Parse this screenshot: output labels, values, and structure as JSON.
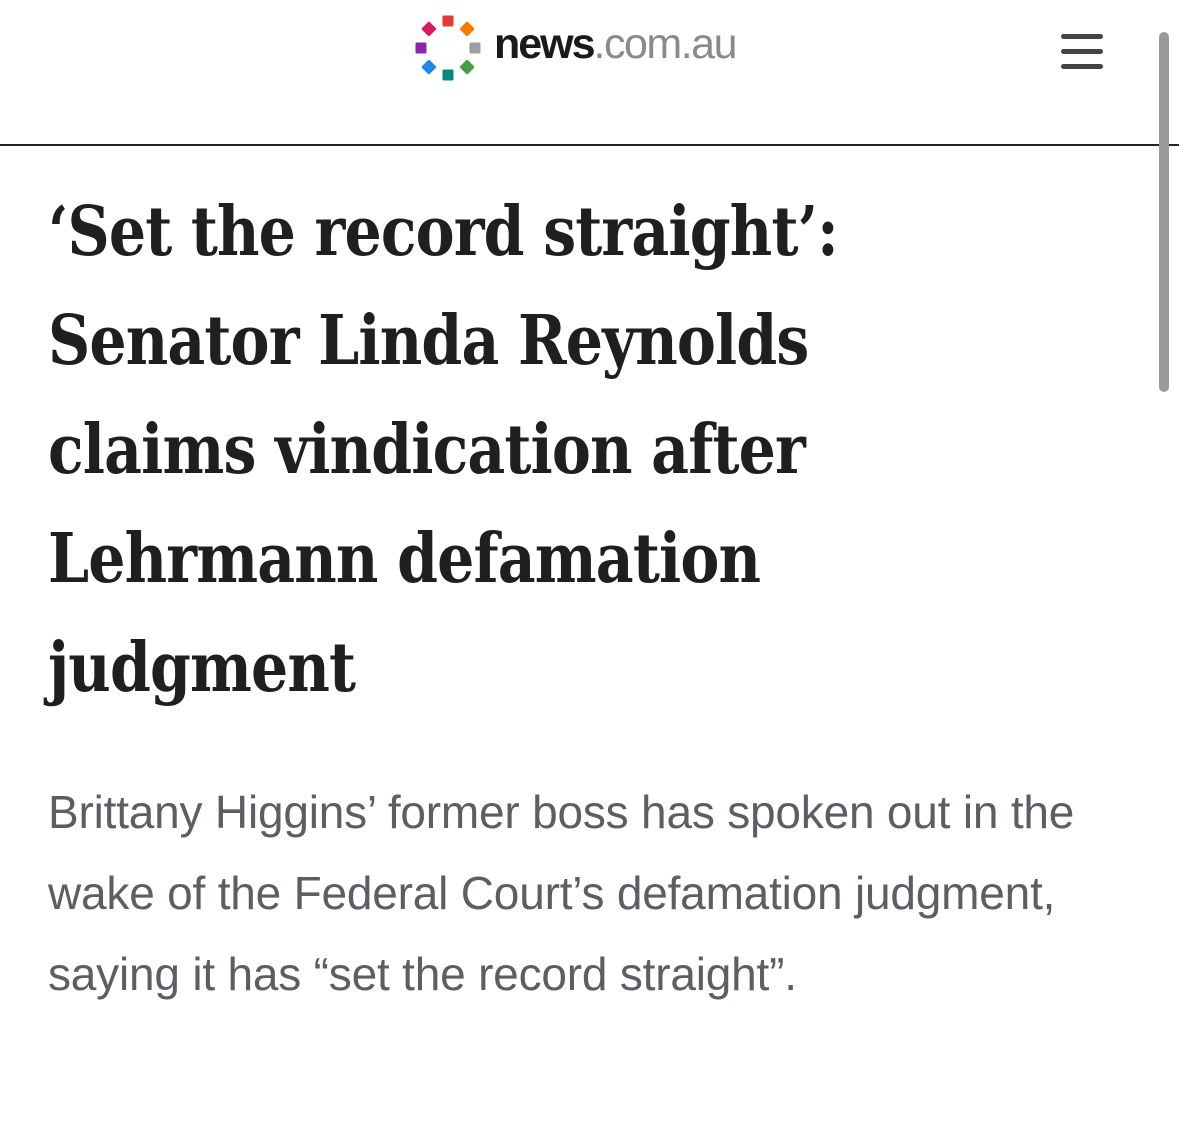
{
  "header": {
    "logo": {
      "name": "news",
      "domain": ".com.au",
      "dot_colors": [
        "#e53935",
        "#f57c00",
        "#9e9e9e",
        "#43a047",
        "#00897b",
        "#1e88e5",
        "#8e24aa",
        "#d81b60"
      ]
    },
    "menu_icon": "hamburger-menu-icon"
  },
  "article": {
    "headline": "‘Set the record straight’: Senator Linda Reynolds claims vindication after Lehrmann defamation judgment",
    "standfirst": "Brittany Higgins’ former boss has spoken out in the wake of the Federal Court’s defamation judgment, saying it has “set the record straight”."
  },
  "colors": {
    "headline": "#1f1f1f",
    "standfirst": "#5b5e63",
    "rule": "#222222"
  }
}
